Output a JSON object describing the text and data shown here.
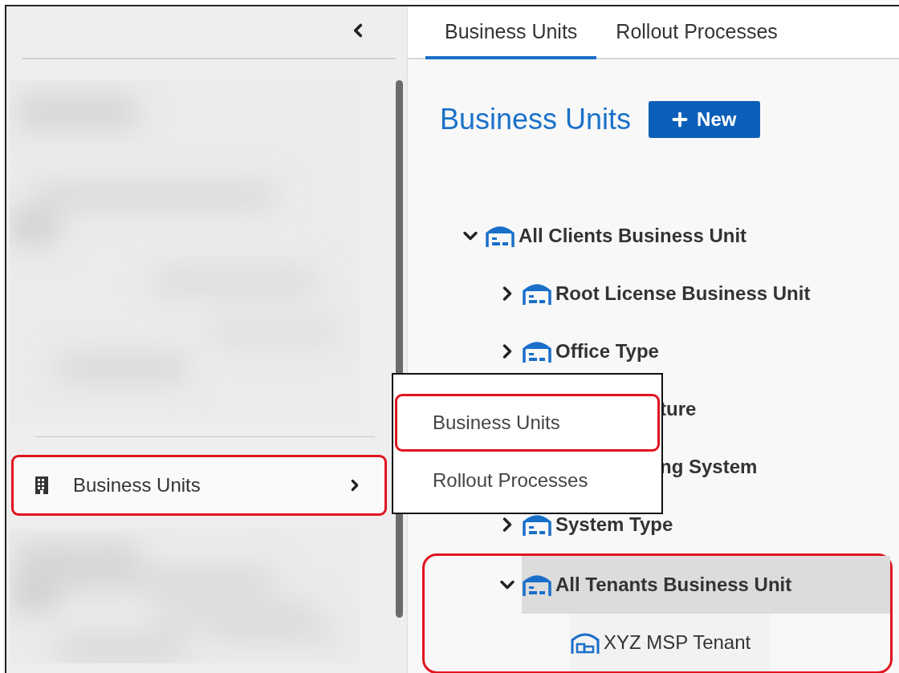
{
  "sidebar": {
    "nav_item": {
      "label": "Business Units",
      "highlighted": true
    },
    "flyout": {
      "items": [
        {
          "label": "Business Units",
          "highlighted": true
        },
        {
          "label": "Rollout Processes",
          "highlighted": false
        }
      ]
    }
  },
  "tabs": [
    {
      "label": "Business Units",
      "selected": true
    },
    {
      "label": "Rollout Processes",
      "selected": false
    }
  ],
  "page": {
    "title": "Business Units",
    "new_button": "New"
  },
  "tree": [
    {
      "label": "All Clients Business Unit",
      "kind": "unit",
      "expanded": true,
      "children": [
        {
          "label": "Root License Business Unit",
          "kind": "unit",
          "expanded": false
        },
        {
          "label": "Office Type",
          "kind": "unit",
          "expanded": false
        },
        {
          "label": "ture",
          "kind": "obscured"
        },
        {
          "label": "ng System",
          "kind": "obscured"
        },
        {
          "label": "System Type",
          "kind": "unit",
          "expanded": false
        },
        {
          "label": "All Tenants Business Unit",
          "kind": "unit",
          "expanded": true,
          "selected": true,
          "highlighted": true,
          "children": [
            {
              "label": "XYZ MSP Tenant",
              "kind": "tenant"
            }
          ]
        }
      ]
    }
  ]
}
